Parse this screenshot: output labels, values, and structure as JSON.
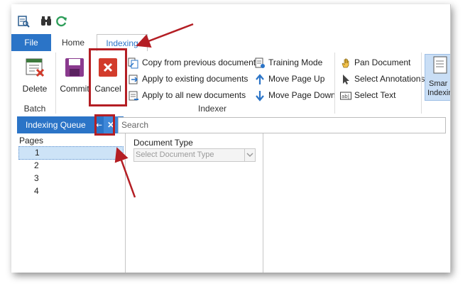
{
  "tabs": {
    "file": "File",
    "home": "Home",
    "indexing": "Indexing"
  },
  "batch": {
    "delete_label": "Delete",
    "commit_label": "Commit",
    "group_label": "Batch"
  },
  "indexer": {
    "cancel_label": "Cancel",
    "copy_prev": "Copy from previous document",
    "apply_existing": "Apply to existing documents",
    "apply_new": "Apply to all new documents",
    "training_mode": "Training Mode",
    "move_up": "Move Page Up",
    "move_down": "Move Page Down",
    "group_label": "Indexer"
  },
  "tools": {
    "pan": "Pan Document",
    "select_annotations": "Select Annotations",
    "select_text": "Select Text",
    "smart_line1": "Smar",
    "smart_line2": "Indexin"
  },
  "panel": {
    "title": "Indexing Queue",
    "pin": "⇤",
    "close": "✕",
    "search_placeholder": "Search"
  },
  "pages": {
    "title": "Pages",
    "items": [
      "1",
      "2",
      "3",
      "4"
    ]
  },
  "document": {
    "type_label": "Document Type",
    "type_placeholder": "Select Document Type"
  },
  "colors": {
    "accent": "#2b74c7",
    "highlight": "#b41e24",
    "cancel_red": "#d23b2b",
    "commit_purple": "#8a3a8e"
  }
}
